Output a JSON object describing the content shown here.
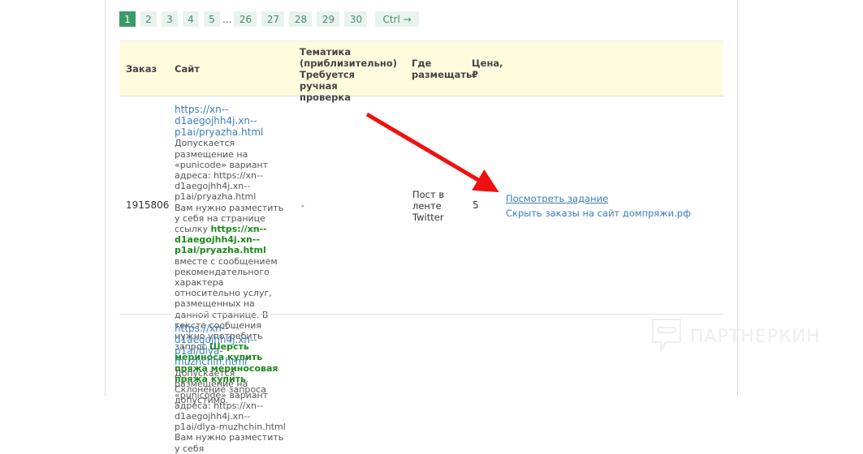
{
  "pagination": {
    "pages": [
      "1",
      "2",
      "3",
      "4",
      "5"
    ],
    "ellipsis": "...",
    "pages_end": [
      "26",
      "27",
      "28",
      "29",
      "30"
    ],
    "next": "Ctrl →",
    "active": "1"
  },
  "table": {
    "headers": {
      "order": "Заказ",
      "site": "Сайт",
      "topic": "Тематика (приблизительно) Требуется ручная проверка",
      "where": "Где размещать",
      "price": "Цена, ₽"
    },
    "rows": [
      {
        "order": "1915806",
        "url": "https://xn--d1aegojhh4j.xn--p1ai/pryazha.html",
        "note1": "Допускается размещение на «punicode» вариант адреса: https://xn--d1aegojhh4j.xn--p1ai/pryazha.html",
        "note2": "Вам нужно разместить у себя на странице ссылку ",
        "link": "https://xn--d1aegojhh4j.xn--p1ai/pryazha.html",
        "note3": " вместе с сообщением рекомендательного характера относительно услуг, размещенных на данной странице. В тексте сообщения нужно употребить запрос ",
        "query": "Шерсть мериноса купить пряжа мериносовая пряжа купить",
        "note4": ". Склонение запроса допустимо.",
        "topic": "-",
        "where": "Пост в ленте Twitter",
        "price": "5",
        "action_view": "Посмотреть задание",
        "action_hide": "Скрыть заказы на сайт домпряжи.рф"
      },
      {
        "url": "https://xn--d1aegojhh4j.xn--p1ai/dlya-muzhchin.html",
        "note1": "Допускается размещение на «punicode» вариант адреса: https://xn--d1aegojhh4j.xn--p1ai/dlya-muzhchin.html",
        "note2": "Вам нужно разместить у себя"
      }
    ]
  },
  "watermark": "ПАРТНЕРКИН"
}
